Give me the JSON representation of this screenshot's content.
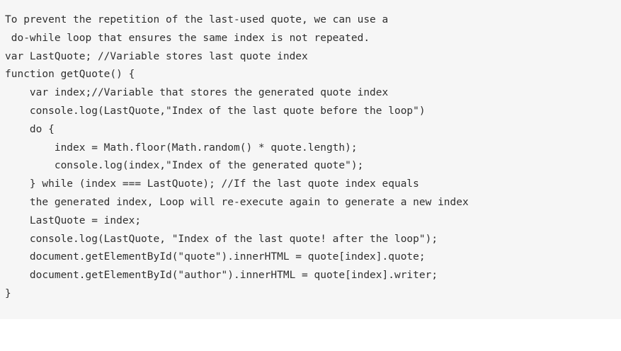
{
  "code_block": {
    "lines": [
      "To prevent the repetition of the last-used quote, we can use a",
      " do-while loop that ensures the same index is not repeated.",
      "var LastQuote; //Variable stores last quote index",
      "function getQuote() {",
      "    var index;//Variable that stores the generated quote index",
      "    console.log(LastQuote,\"Index of the last quote before the loop\")",
      "    do {",
      "        index = Math.floor(Math.random() * quote.length);",
      "        console.log(index,\"Index of the generated quote\");",
      "    } while (index === LastQuote); //If the last quote index equals",
      "    the generated index, Loop will re-execute again to generate a new index",
      "    LastQuote = index;",
      "    console.log(LastQuote, \"Index of the last quote! after the loop\");",
      "    document.getElementById(\"quote\").innerHTML = quote[index].quote;",
      "    document.getElementById(\"author\").innerHTML = quote[index].writer;",
      "}"
    ]
  }
}
